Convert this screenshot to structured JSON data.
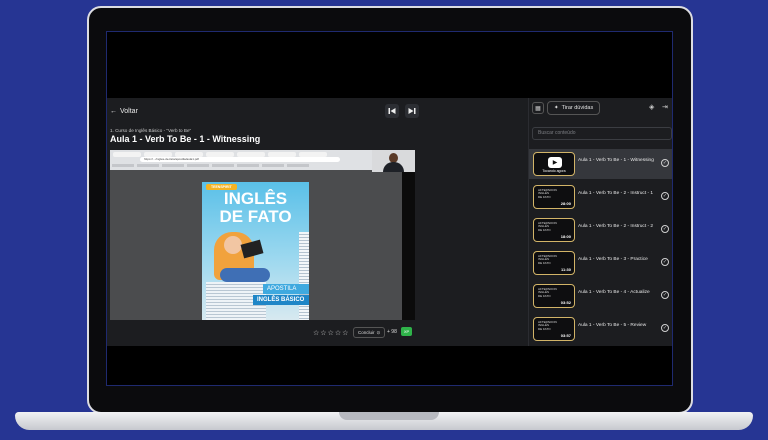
{
  "header": {
    "back_label": "Voltar",
    "course_label": "1. Curso de Inglês Básico - \"Verb to Be\"",
    "lesson_title": "Aula 1 - Verb To Be - 1 - Witnessing"
  },
  "video": {
    "address_text": "https://.../ingles-de-fato/apostila/aula1.pdf",
    "book": {
      "tag": "TEENSPIRIT",
      "title": "INGLÊS\nDE FATO",
      "apostila": "APOSTILA",
      "subtitle": "INGLÊS BÁSICO"
    }
  },
  "footer": {
    "stars": [
      "☆",
      "☆",
      "☆",
      "☆",
      "☆"
    ],
    "conclude_label": "Concluir",
    "xp_label": "+ 98",
    "xp_badge": "XP"
  },
  "sidebar": {
    "ask_label": "Tirar dúvidas",
    "search_placeholder": "Buscar conteúdo",
    "thumb_logo": "AFTERNOON\nINGLÊS\nDE FATO",
    "now_playing": "Tocando agora",
    "items": [
      {
        "title": "Aula 1 - Verb To Be - 1 - Witnessing",
        "duration": ""
      },
      {
        "title": "Aula 1 - Verb To Be - 2 - Instruct - 1",
        "duration": "28:00"
      },
      {
        "title": "Aula 1 - Verb To Be - 2 - Instruct - 2",
        "duration": "18:00"
      },
      {
        "title": "Aula 1 - Verb To Be - 3 - Practice",
        "duration": "11:30"
      },
      {
        "title": "Aula 1 - Verb To Be - 4 - Actualize",
        "duration": "03:52"
      },
      {
        "title": "Aula 1 - Verb To Be - 5 - Review",
        "duration": "03:57"
      }
    ]
  }
}
